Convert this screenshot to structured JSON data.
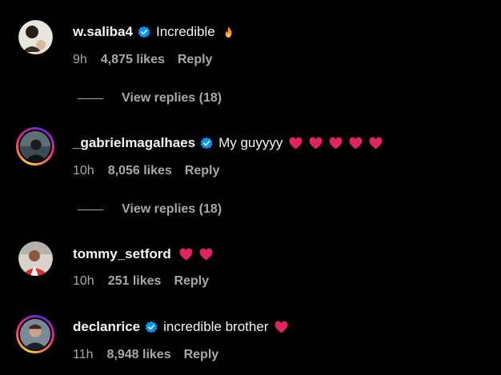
{
  "comments": [
    {
      "username": "w.saliba4",
      "verified": true,
      "text": "Incredible",
      "emojis": [
        "fire-emoji"
      ],
      "time": "9h",
      "likes": "4,875 likes",
      "reply": "Reply",
      "view_replies": "View replies (18)"
    },
    {
      "username": "_gabrielmagalhaes",
      "verified": true,
      "text": "My guyyyy",
      "emojis": [
        "red-heart-emoji",
        "red-heart-emoji",
        "red-heart-emoji",
        "red-heart-emoji",
        "red-heart-emoji"
      ],
      "time": "10h",
      "likes": "8,056 likes",
      "reply": "Reply",
      "view_replies": "View replies (18)"
    },
    {
      "username": "tommy_setford",
      "verified": false,
      "text": "",
      "emojis": [
        "red-heart-emoji",
        "red-heart-emoji"
      ],
      "time": "10h",
      "likes": "251 likes",
      "reply": "Reply"
    },
    {
      "username": "declanrice",
      "verified": true,
      "text": "incredible brother",
      "emojis": [
        "red-heart-emoji"
      ],
      "time": "11h",
      "likes": "8,948 likes",
      "reply": "Reply"
    }
  ],
  "colors": {
    "background": "#000000",
    "text": "#f5f5f5",
    "secondary": "#a8a8a8",
    "verified": "#0095f6",
    "heart": "#e0245e"
  }
}
